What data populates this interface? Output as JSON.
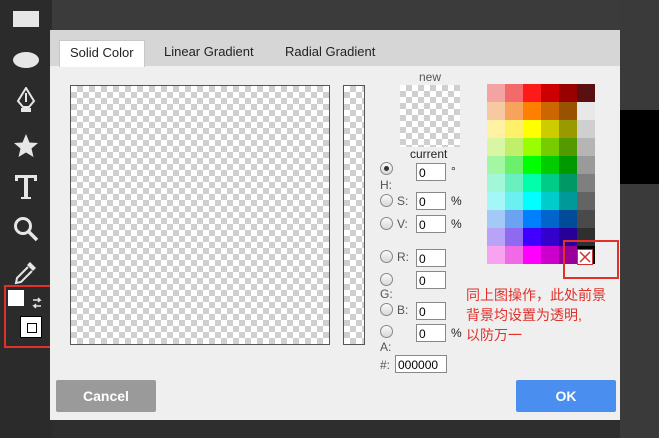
{
  "toolbar": {
    "tools": [
      {
        "name": "rectangle-tool",
        "icon": "rectangle-icon"
      },
      {
        "name": "ellipse-tool",
        "icon": "ellipse-icon"
      },
      {
        "name": "pen-tool",
        "icon": "pen-icon"
      },
      {
        "name": "star-tool",
        "icon": "star-icon"
      },
      {
        "name": "text-tool",
        "icon": "text-icon"
      },
      {
        "name": "zoom-tool",
        "icon": "magnifier-icon"
      },
      {
        "name": "eyedropper-tool",
        "icon": "eyedropper-icon"
      }
    ],
    "swap_icon": "swap-arrows-icon"
  },
  "dialog": {
    "tabs": [
      "Solid Color",
      "Linear Gradient",
      "Radial Gradient"
    ],
    "active_tab": 0,
    "new_label": "new",
    "current_label": "current",
    "hsv": {
      "h_label": "H:",
      "h_value": "0",
      "h_unit": "°",
      "s_label": "S:",
      "s_value": "0",
      "s_unit": "%",
      "v_label": "V:",
      "v_value": "0",
      "v_unit": "%"
    },
    "rgba": {
      "r_label": "R:",
      "r_value": "0",
      "g_label": "G:",
      "g_value": "0",
      "b_label": "B:",
      "b_value": "0",
      "a_label": "A:",
      "a_value": "0",
      "a_unit": "%"
    },
    "hex_label": "#:",
    "hex_value": "000000",
    "cancel_label": "Cancel",
    "ok_label": "OK"
  },
  "annotation": {
    "lines": [
      "同上图操作，此处前景",
      "背景均设置为透明,",
      "以防万一"
    ],
    "color": "#e0312b"
  },
  "palette_colors": [
    [
      "#f4a3a3",
      "#f46a6a",
      "#ff1a1a",
      "#cc0000",
      "#990000",
      "#5a1010"
    ],
    [
      "#f7c9a3",
      "#f7a35e",
      "#ff8000",
      "#cc6600",
      "#995200",
      "#e8e8e8"
    ],
    [
      "#fff3a3",
      "#fff06a",
      "#ffff00",
      "#cccc00",
      "#999900",
      "#cfcfcf"
    ],
    [
      "#d9f7a3",
      "#c0f06a",
      "#99ff00",
      "#77cc00",
      "#559900",
      "#b5b5b5"
    ],
    [
      "#a3f7a3",
      "#6af06a",
      "#00ff00",
      "#00cc00",
      "#009900",
      "#9a9a9a"
    ],
    [
      "#a3f7d9",
      "#6af0c0",
      "#00ffaa",
      "#00cc88",
      "#009966",
      "#7f7f7f"
    ],
    [
      "#a3f7f7",
      "#6af0f0",
      "#00ffff",
      "#00cccc",
      "#009999",
      "#646464"
    ],
    [
      "#a3c9f7",
      "#6aa3f0",
      "#0080ff",
      "#0066cc",
      "#004c99",
      "#4a4a4a"
    ],
    [
      "#b9a3f7",
      "#8f6af0",
      "#4000ff",
      "#3300cc",
      "#260099",
      "#2f2f2f"
    ],
    [
      "#f7a3f0",
      "#f06ae6",
      "#ff00ff",
      "#cc00cc",
      "#990099",
      "#000000"
    ]
  ]
}
